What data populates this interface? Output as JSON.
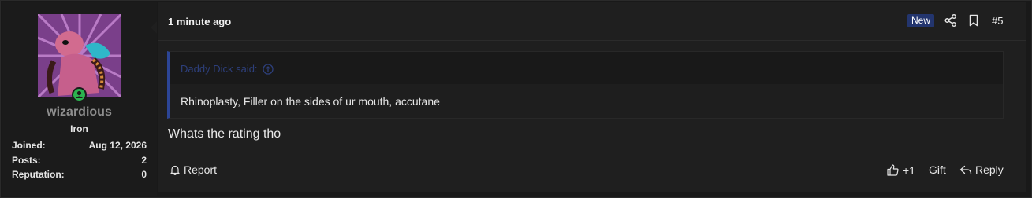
{
  "user": {
    "username": "wizardious",
    "rank": "Iron",
    "stats": [
      {
        "label": "Joined:",
        "value": "Aug 12, 2026"
      },
      {
        "label": "Posts:",
        "value": "2"
      },
      {
        "label": "Reputation:",
        "value": "0"
      }
    ],
    "online_color": "#2bb34f"
  },
  "post": {
    "time": "1 minute ago",
    "new_badge": "New",
    "number": "#5",
    "quote": {
      "author_line": "Daddy Dick said:",
      "text": "Rhinoplasty, Filler on the sides of ur mouth, accutane"
    },
    "message": "Whats the rating tho"
  },
  "footer": {
    "report_label": "Report",
    "like_count": "+1",
    "gift_label": "Gift",
    "reply_label": "Reply"
  },
  "colors": {
    "accent": "#2c4596",
    "badge": "#23356e",
    "username": "#8e8e8e"
  },
  "icons": [
    "share-icon",
    "bookmark-icon",
    "quote-jump-icon",
    "bell-icon",
    "thumbs-up-icon",
    "reply-icon",
    "online-status-icon"
  ]
}
